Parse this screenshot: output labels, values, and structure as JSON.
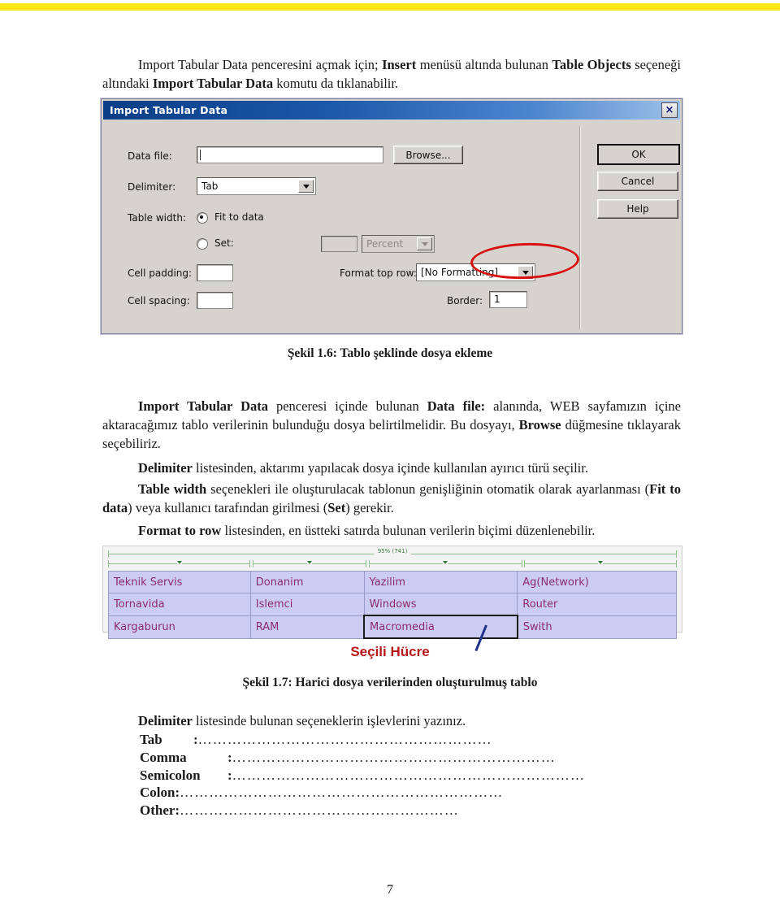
{
  "document": {
    "page_number": "7",
    "accent_bar_color": "#fbe816"
  },
  "intro_paragraph": {
    "part1": "Import Tabular Data penceresini açmak için; ",
    "bold1": "Insert",
    "part2": " menüsü altında bulunan ",
    "bold2": "Table Objects",
    "part3": " seçeneği altındaki ",
    "bold3": "Import Tabular Data",
    "part4": " komutu da tıklanabilir."
  },
  "dialog": {
    "title": "Import Tabular Data",
    "close_label": "×",
    "fields": {
      "data_file_label": "Data file:",
      "data_file_value": "",
      "browse_label": "Browse...",
      "delimiter_label": "Delimiter:",
      "delimiter_value": "Tab",
      "table_width_label": "Table width:",
      "fit_to_data_label": "Fit to data",
      "set_label": "Set:",
      "set_value": "",
      "percent_value": "Percent",
      "cell_padding_label": "Cell padding:",
      "cell_padding_value": "",
      "cell_spacing_label": "Cell spacing:",
      "cell_spacing_value": "",
      "format_top_row_label": "Format top row:",
      "format_top_row_value": "[No Formatting]",
      "border_label": "Border:",
      "border_value": "1"
    },
    "buttons": {
      "ok": "OK",
      "cancel": "Cancel",
      "help": "Help"
    }
  },
  "figure_1_6": {
    "caption": "Şekil 1.6: Tablo şeklinde dosya ekleme"
  },
  "paragraphs": {
    "p1": {
      "b1": "Import Tabular Data",
      "t1": " penceresi içinde bulunan ",
      "b2": "Data file:",
      "t2": " alanında, WEB sayfamızın içine aktaracağımız tablo verilerinin bulunduğu dosya belirtilmelidir. Bu dosyayı, ",
      "b3": "Browse",
      "t3": " düğmesine tıklayarak seçebiliriz."
    },
    "p2": {
      "b1": "Delimiter",
      "t1": " listesinden, aktarımı yapılacak dosya içinde kullanılan ayırıcı türü seçilir."
    },
    "p3": {
      "b1": "Table width",
      "t1": " seçenekleri ile oluşturulacak tablonun genişliğinin otomatik olarak ayarlanması (",
      "b2": "Fit to data",
      "t2": ") veya kullanıcı tarafından girilmesi (",
      "b3": "Set",
      "t3": ") gerekir."
    },
    "p4": {
      "b1": "Format to row",
      "t1": " listesinden, en üstteki satırda bulunan verilerin biçimi düzenlenebilir."
    }
  },
  "table_figure": {
    "width_indicator": "95% (741)",
    "rows": [
      [
        "Teknik Servis",
        "Donanim",
        "Yazilim",
        "Ag(Network)"
      ],
      [
        "Tornavida",
        "Islemci",
        "Windows",
        "Router"
      ],
      [
        "Kargaburun",
        "RAM",
        "Macromedia",
        "Swith"
      ]
    ],
    "selected_cell": {
      "row": 2,
      "col": 2,
      "text": "Macromedia"
    },
    "annotation": "Seçili Hücre",
    "annotation_color": "#b81818"
  },
  "figure_1_7": {
    "caption": "Şekil 1.7: Harici dosya verilerinden oluşturulmuş tablo"
  },
  "exercise": {
    "instruction_bold": "Delimiter",
    "instruction_rest": " listesinde bulunan seçeneklerin işlevlerini yazınız.",
    "items": [
      {
        "label": "Tab",
        "colon": ":",
        "dots": "……………………………………………………"
      },
      {
        "label": "Comma",
        "colon": ":",
        "dots": "…………………………………………………………"
      },
      {
        "label": "Semicolon",
        "colon": ":",
        "dots": "………………………………………………………………"
      },
      {
        "label": "Colon:",
        "colon": "",
        "dots": "…………………………………………………………"
      },
      {
        "label": "Other:",
        "colon": "",
        "dots": "…………………………………………………"
      }
    ]
  }
}
